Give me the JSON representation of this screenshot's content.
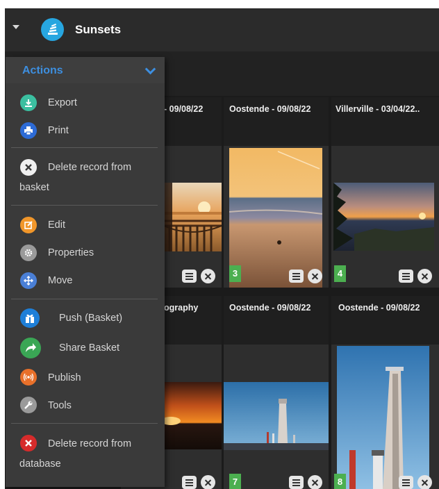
{
  "header": {
    "title": "Sunsets"
  },
  "menu": {
    "title": "Actions",
    "items": {
      "export": "Export",
      "print": "Print",
      "delete_basket_1": "Delete record from",
      "delete_basket_2": "basket",
      "edit": "Edit",
      "properties": "Properties",
      "move": "Move",
      "push": "Push (Basket)",
      "share": "Share Basket",
      "publish": "Publish",
      "tools": "Tools",
      "delete_db_1": "Delete record from",
      "delete_db_2": "database"
    }
  },
  "cards": [
    {
      "title": "- 09/08/22"
    },
    {
      "title": "Oostende - 09/08/22",
      "number": "3"
    },
    {
      "title": "Villerville - 03/04/22..",
      "number": "4"
    },
    {
      "title": "ography"
    },
    {
      "title": "Oostende - 09/08/22",
      "number": "7"
    },
    {
      "title": "Oostende - 09/08/22",
      "number": "8"
    }
  ],
  "colors": {
    "accent": "#3d8fe0",
    "badge": "#4caf50",
    "logo": "#27a6e0"
  }
}
